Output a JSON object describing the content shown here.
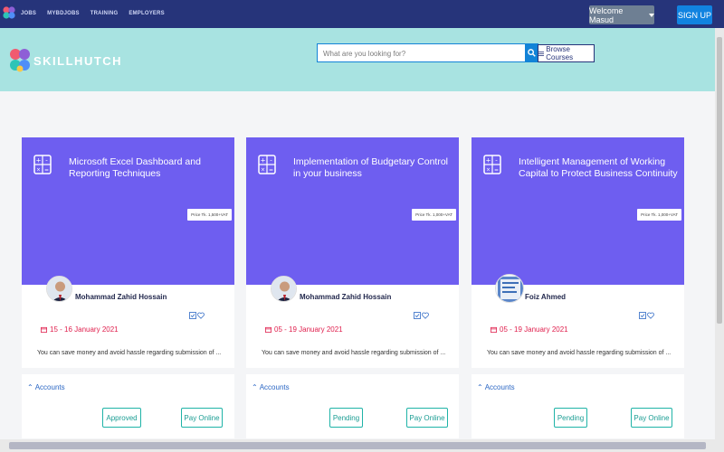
{
  "nav": {
    "links": [
      "JOBS",
      "MYBDJOBS",
      "TRAINING",
      "EMPLOYERS"
    ],
    "welcome_label": "Welcome Masud",
    "signup_label": "SIGN UP"
  },
  "header": {
    "brand": "SKILLHUTCH",
    "search_placeholder": "What are you looking for?",
    "browse_label": "Browse Courses"
  },
  "cards": [
    {
      "title": "Microsoft Excel Dashboard and Reporting Techniques",
      "price": "Price Tk. 1,500+VAT",
      "trainer": "Mohammad Zahid Hossain",
      "date": "15 - 16 January 2021",
      "description": "You can save money and avoid hassle regarding submission of ...",
      "category": "Accounts",
      "status": "Approved",
      "pay_label": "Pay Online"
    },
    {
      "title": "Implementation of Budgetary Control in your business",
      "price": "Price Tk. 1,000+VAT",
      "trainer": "Mohammad Zahid Hossain",
      "date": "05 - 19 January 2021",
      "description": "You can save money and avoid hassle regarding submission of ...",
      "category": "Accounts",
      "status": "Pending",
      "pay_label": "Pay Online"
    },
    {
      "title": "Intelligent Management of Working Capital to Protect Business Continuity",
      "price": "Price Tk. 1,000+VAT",
      "trainer": "Foiz Ahmed",
      "date": "05 - 19 January 2021",
      "description": "You can save money and avoid hassle regarding submission of ...",
      "category": "Accounts",
      "status": "Pending",
      "pay_label": "Pay Online"
    }
  ],
  "colors": {
    "nav_bg": "#26347a",
    "header_bg": "#a8e3e1",
    "card_hero": "#6e5ef0",
    "date_red": "#e0204e",
    "teal": "#1fb3a7",
    "primary_blue": "#1183e0"
  }
}
